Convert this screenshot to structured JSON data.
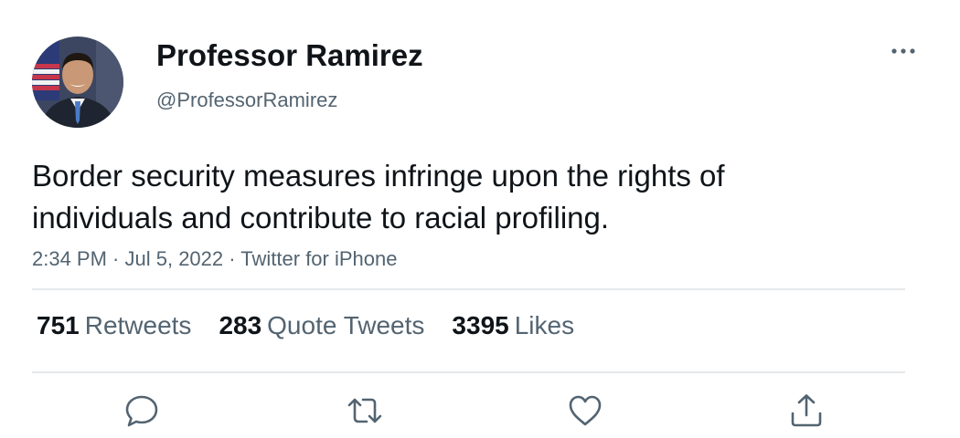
{
  "tweet": {
    "display_name": "Professor Ramirez",
    "handle": "@ProfessorRamirez",
    "text_lines": [
      "Border security measures infringe upon the rights of",
      "individuals and contribute to racial profiling."
    ],
    "meta": {
      "time": "2:34 PM",
      "separator": " · ",
      "date": "Jul 5, 2022",
      "source": "Twitter for iPhone"
    },
    "stats": [
      {
        "count": "751",
        "label": "Retweets"
      },
      {
        "count": "283",
        "label": "Quote Tweets"
      },
      {
        "count": "3395",
        "label": "Likes"
      }
    ]
  },
  "icons": {
    "more": "more-horizontal-icon",
    "reply": "reply-bubble-icon",
    "retweet": "retweet-icon",
    "like": "heart-icon",
    "share": "share-upload-icon"
  },
  "colors": {
    "text_primary": "#0f1419",
    "text_secondary": "#536471",
    "divider": "#e6e9eb"
  }
}
